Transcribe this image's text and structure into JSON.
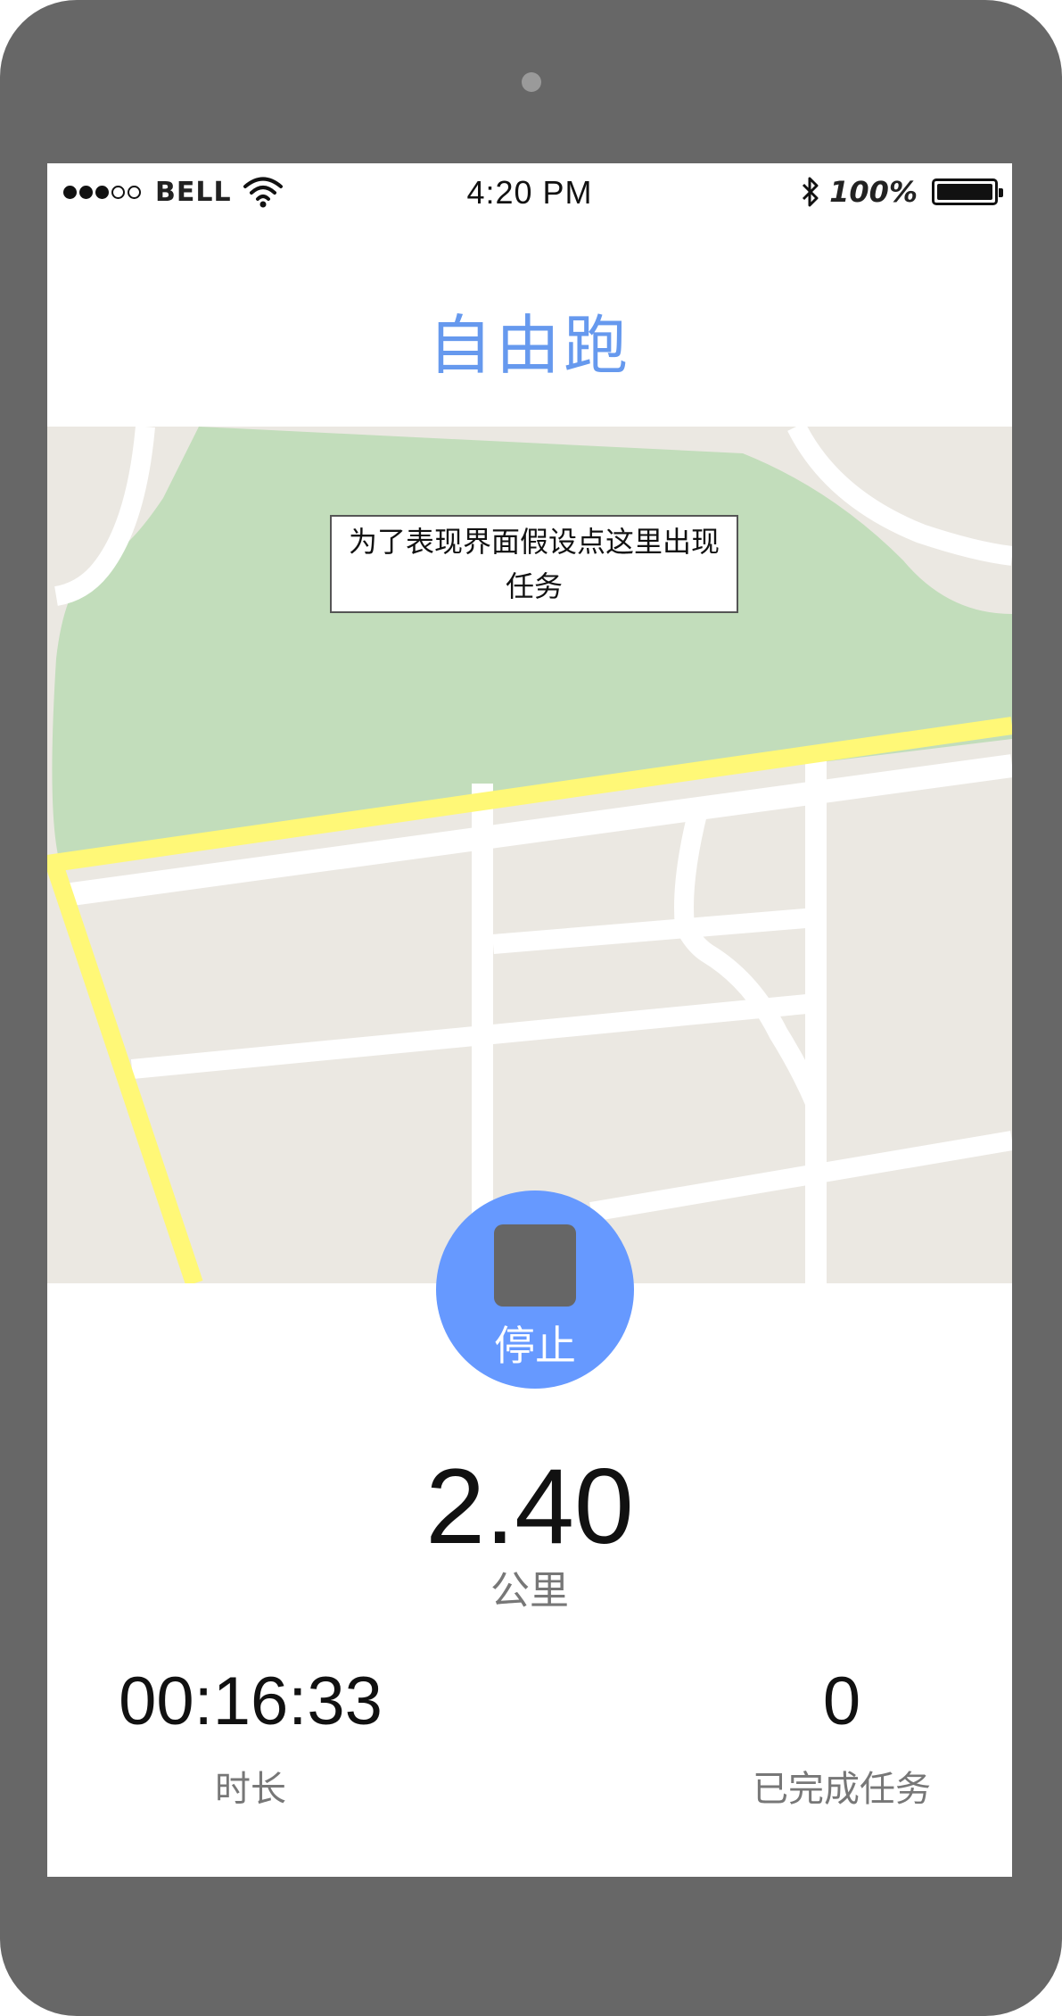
{
  "status_bar": {
    "signal_dots_filled": 3,
    "signal_dots_total": 5,
    "carrier": "BELL",
    "wifi_icon": "wifi-icon",
    "time": "4:20 PM",
    "bluetooth_icon": "bluetooth-icon",
    "battery_percent": "100%",
    "battery_icon": "battery-icon"
  },
  "header": {
    "title": "自由跑"
  },
  "map": {
    "task_popup": "为了表现界面假设点这里出现任务",
    "colors": {
      "land": "#ebe8e2",
      "park": "#c2ddbb",
      "road": "#ffffff",
      "route": "#fff877"
    }
  },
  "controls": {
    "stop_label": "停止",
    "stop_icon": "stop-icon",
    "accent": "#6699ff"
  },
  "stats": {
    "distance": "2.40",
    "distance_unit": "公里",
    "duration": "00:16:33",
    "duration_label": "时长",
    "tasks_completed": "0",
    "tasks_label": "已完成任务"
  }
}
